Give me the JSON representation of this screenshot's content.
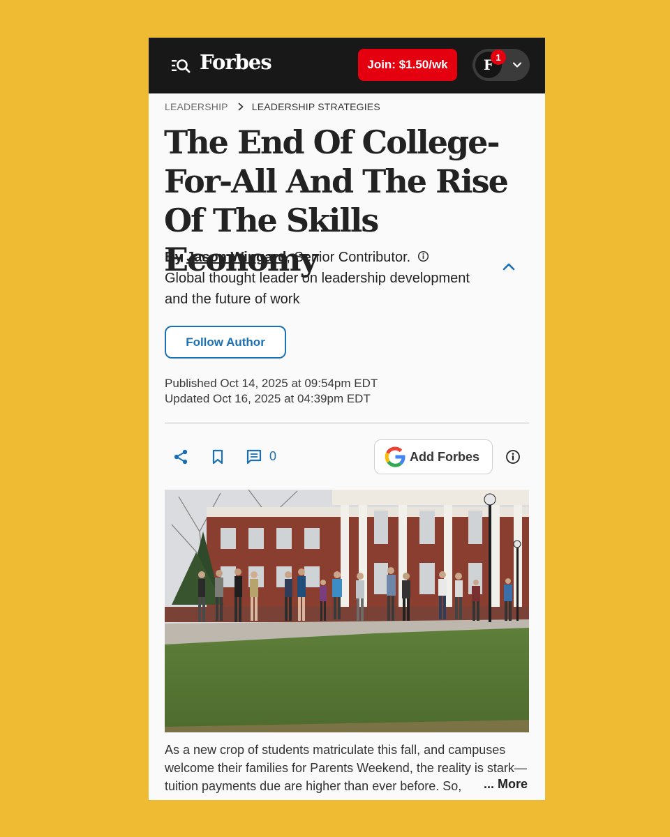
{
  "header": {
    "brand": "Forbes",
    "join_label": "Join: $1.50/wk",
    "account_initial": "F",
    "notification_count": "1"
  },
  "breadcrumb": [
    "LEADERSHIP",
    "LEADERSHIP STRATEGIES"
  ],
  "article": {
    "title": "The End Of College-For-All And The Rise Of The Skills Economy",
    "by_label": "By",
    "author": "Jason Wingard",
    "author_role": ", Senior Contributor.",
    "author_bio": "Global thought leader on leadership development and the future of work",
    "follow_label": "Follow Author",
    "published": "Published Oct 14, 2025 at 09:54pm EDT",
    "updated": "Updated Oct 16, 2025 at 04:39pm EDT",
    "excerpt": "As a new crop of students matriculate this fall, and campuses welcome their families for Parents Weekend, the reality is stark—tuition payments due are higher than ever before. So,",
    "more_label": "... More"
  },
  "actions": {
    "comment_count": "0",
    "add_forbes_label": "Add Forbes"
  },
  "colors": {
    "page_background": "#EEBB33",
    "header_background": "#181818",
    "join_button": "#E4000F",
    "link_blue": "#1B6FB4"
  },
  "icons": [
    "menu-search-icon",
    "chevron-down-icon",
    "chevron-right-icon",
    "info-icon",
    "chevron-up-icon",
    "share-icon",
    "bookmark-icon",
    "comment-icon",
    "google-icon"
  ]
}
